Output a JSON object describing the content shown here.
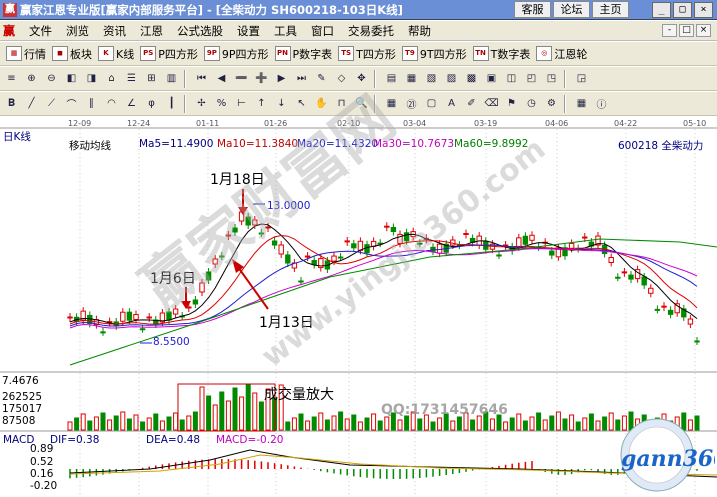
{
  "window": {
    "title": "赢家江恩专业版[赢家内部服务平台] - [全柴动力   SH600218-103日K线]",
    "top_links": [
      "客服",
      "论坛",
      "主页"
    ],
    "controls": [
      "_",
      "□",
      "×"
    ]
  },
  "menubar": {
    "logo": "赢",
    "items": [
      "文件",
      "浏览",
      "资讯",
      "江恩",
      "公式选股",
      "设置",
      "工具",
      "窗口",
      "交易委托",
      "帮助"
    ],
    "mdi_controls": [
      "-",
      "□",
      "×"
    ]
  },
  "toolbar1": {
    "items": [
      {
        "icon": "grid-icon",
        "glyph": "▦",
        "label": "行情"
      },
      {
        "icon": "blocks-icon",
        "glyph": "◼",
        "label": "板块"
      },
      {
        "icon": "kline-icon",
        "glyph": "K",
        "label": "K线"
      },
      {
        "icon": "p-square-icon",
        "glyph": "PS",
        "label": "P四方形"
      },
      {
        "icon": "9p-square-icon",
        "glyph": "9P",
        "label": "9P四方形"
      },
      {
        "icon": "p-number-table-icon",
        "glyph": "PN",
        "label": "P数字表"
      },
      {
        "icon": "t-square-icon",
        "glyph": "TS",
        "label": "T四方形"
      },
      {
        "icon": "9t-square-icon",
        "glyph": "T9",
        "label": "9T四方形"
      },
      {
        "icon": "t-number-table-icon",
        "glyph": "TN",
        "label": "T数字表"
      },
      {
        "icon": "gann-wheel-icon",
        "glyph": "◎",
        "label": "江恩轮"
      }
    ]
  },
  "toolbar2": {
    "icons": [
      "menu-list-icon",
      "chart-tool-icon",
      "chart-tool-icon",
      "chart-tool-icon",
      "chart-tool-icon",
      "chart-tool-icon",
      "chart-tool-icon",
      "chart-tool-icon",
      "chart-tool-icon",
      "first-icon",
      "prev-icon",
      "zoom-out-icon",
      "zoom-in-icon",
      "next-icon",
      "last-icon",
      "pen-icon",
      "shape-icon",
      "tool-icon",
      "chart-icon",
      "panel-icon",
      "panel-icon",
      "panel-icon",
      "panel-icon",
      "panel-icon",
      "panel-icon",
      "panel-icon",
      "panel-icon",
      "panel-icon"
    ]
  },
  "toolbar3": {
    "icons": [
      "bold-icon",
      "line-icon",
      "fan-icon",
      "arc-icon",
      "channel-icon",
      "cycle-icon",
      "gann-angle-icon",
      "fib-icon",
      "bars-icon",
      "cursor-icon",
      "percent-icon",
      "ruler-icon",
      "up-arrow-icon",
      "down-arrow-icon",
      "pointer-icon",
      "hand-icon",
      "magnet-icon",
      "zoom-icon",
      "calendar-icon",
      "calendar-21-icon",
      "box-icon",
      "text-icon",
      "brush-icon",
      "eraser-icon",
      "flag-icon",
      "clock-icon",
      "settings-icon",
      "grid-icon",
      "info-icon"
    ]
  },
  "chart": {
    "period_label": "日K线",
    "stock_label": "600218  全柴动力",
    "date_axis": [
      "12-09",
      "12-24",
      "01-11",
      "01-26",
      "02-10",
      "03-04",
      "03-19",
      "04-06",
      "04-22",
      "05-10"
    ],
    "ma_header": {
      "label": "移动均线",
      "ma5": "Ma5=11.4900",
      "ma10": "Ma10=11.3840",
      "ma20": "Ma20=11.4320",
      "ma30": "Ma30=10.7673",
      "ma60": "Ma60=9.8992"
    },
    "annotations": {
      "jan18": "1月18日",
      "jan6": "1月6日",
      "jan13": "1月13日",
      "high": "13.0000",
      "low": "8.5500",
      "volume_note": "成交量放大"
    },
    "volume_axis": [
      "7.4676",
      "262525",
      "175017",
      "87508"
    ],
    "macd_header": {
      "label": "MACD",
      "dif": "DIF=0.38",
      "dea": "DEA=0.48",
      "macd": "MACD=-0.20"
    },
    "macd_axis": [
      "0.89",
      "0.52",
      "0.16",
      "-0.20"
    ],
    "qq": "QQ:1731457646"
  },
  "watermark": {
    "line1": "赢家财富网",
    "line2": "www.yingjia360.com",
    "logo": "gann360"
  },
  "colors": {
    "up": "#e00000",
    "down": "#008a00",
    "ma5": "#000000",
    "ma10": "#e00000",
    "ma20": "#2020d0",
    "ma30": "#d000d0",
    "ma60": "#008a00"
  }
}
